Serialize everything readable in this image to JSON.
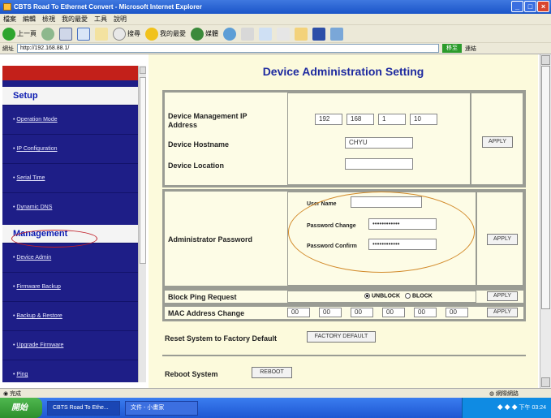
{
  "window": {
    "title": "CBTS Road To Ethernet Convert - Microsoft Internet Explorer",
    "controls": [
      "_",
      "□",
      "×"
    ]
  },
  "menubar": [
    "檔案",
    "編輯",
    "檢視",
    "我的最愛",
    "工具",
    "說明"
  ],
  "toolbar": {
    "back_label": "上一頁",
    "search_label": "搜尋",
    "favorites_label": "我的最愛",
    "media_label": "媒體"
  },
  "addressbar": {
    "label": "網址",
    "url": "http://192.168.88.1/",
    "go_label": "移至",
    "links_label": "連結"
  },
  "sidebar": {
    "setup_heading": "Setup",
    "setup_items": [
      "Operation Mode",
      "IP Configuration",
      "Serial Time",
      "Dynamic DNS"
    ],
    "management_heading": "Management",
    "management_items": [
      "Device Admin",
      "Firmware Backup",
      "Backup & Restore",
      "Upgrade Firmware",
      "Ping"
    ]
  },
  "main": {
    "title": "Device Administration Setting",
    "device_mgmt_ip_label": "Device Management IP Address",
    "ip_octets": [
      "192",
      "168",
      "1",
      "10"
    ],
    "hostname_label": "Device Hostname",
    "hostname_value": "CHYU",
    "location_label": "Device Location",
    "location_value": "",
    "apply_label": "APPLY",
    "admin_password_label": "Administrator Password",
    "user_name_label": "User Name",
    "user_name_value": "",
    "password_change_label": "Password Change",
    "password_change_value": "••••••••••••",
    "password_confirm_label": "Password Confirm",
    "password_confirm_value": "••••••••••••",
    "block_ping_label": "Block Ping Request",
    "unblock_label": "UNBLOCK",
    "block_label": "BLOCK",
    "block_ping_selected": "UNBLOCK",
    "mac_change_label": "MAC Address Change",
    "mac_octets": [
      "00",
      "00",
      "00",
      "00",
      "00",
      "00"
    ],
    "factory_reset_label": "Reset System to Factory Default",
    "factory_default_button": "FACTORY DEFAULT",
    "reboot_label": "Reboot System",
    "reboot_button": "REBOOT"
  },
  "statusbar": {
    "status_text": "完成",
    "zone_text": "網際網路"
  },
  "taskbar": {
    "start_label": "開始",
    "tasks": [
      "CBTS Road To Ethe...",
      "文件 - 小畫家"
    ],
    "clock": "下午 03:24"
  },
  "colors": {
    "sidebar_bg": "#1e1e87",
    "sidebar_accent": "#c3201a",
    "main_bg": "#fcfadc",
    "title_color": "#1e2aa0",
    "annotation_red": "#c1202a",
    "annotation_orange": "#d28a2a"
  }
}
